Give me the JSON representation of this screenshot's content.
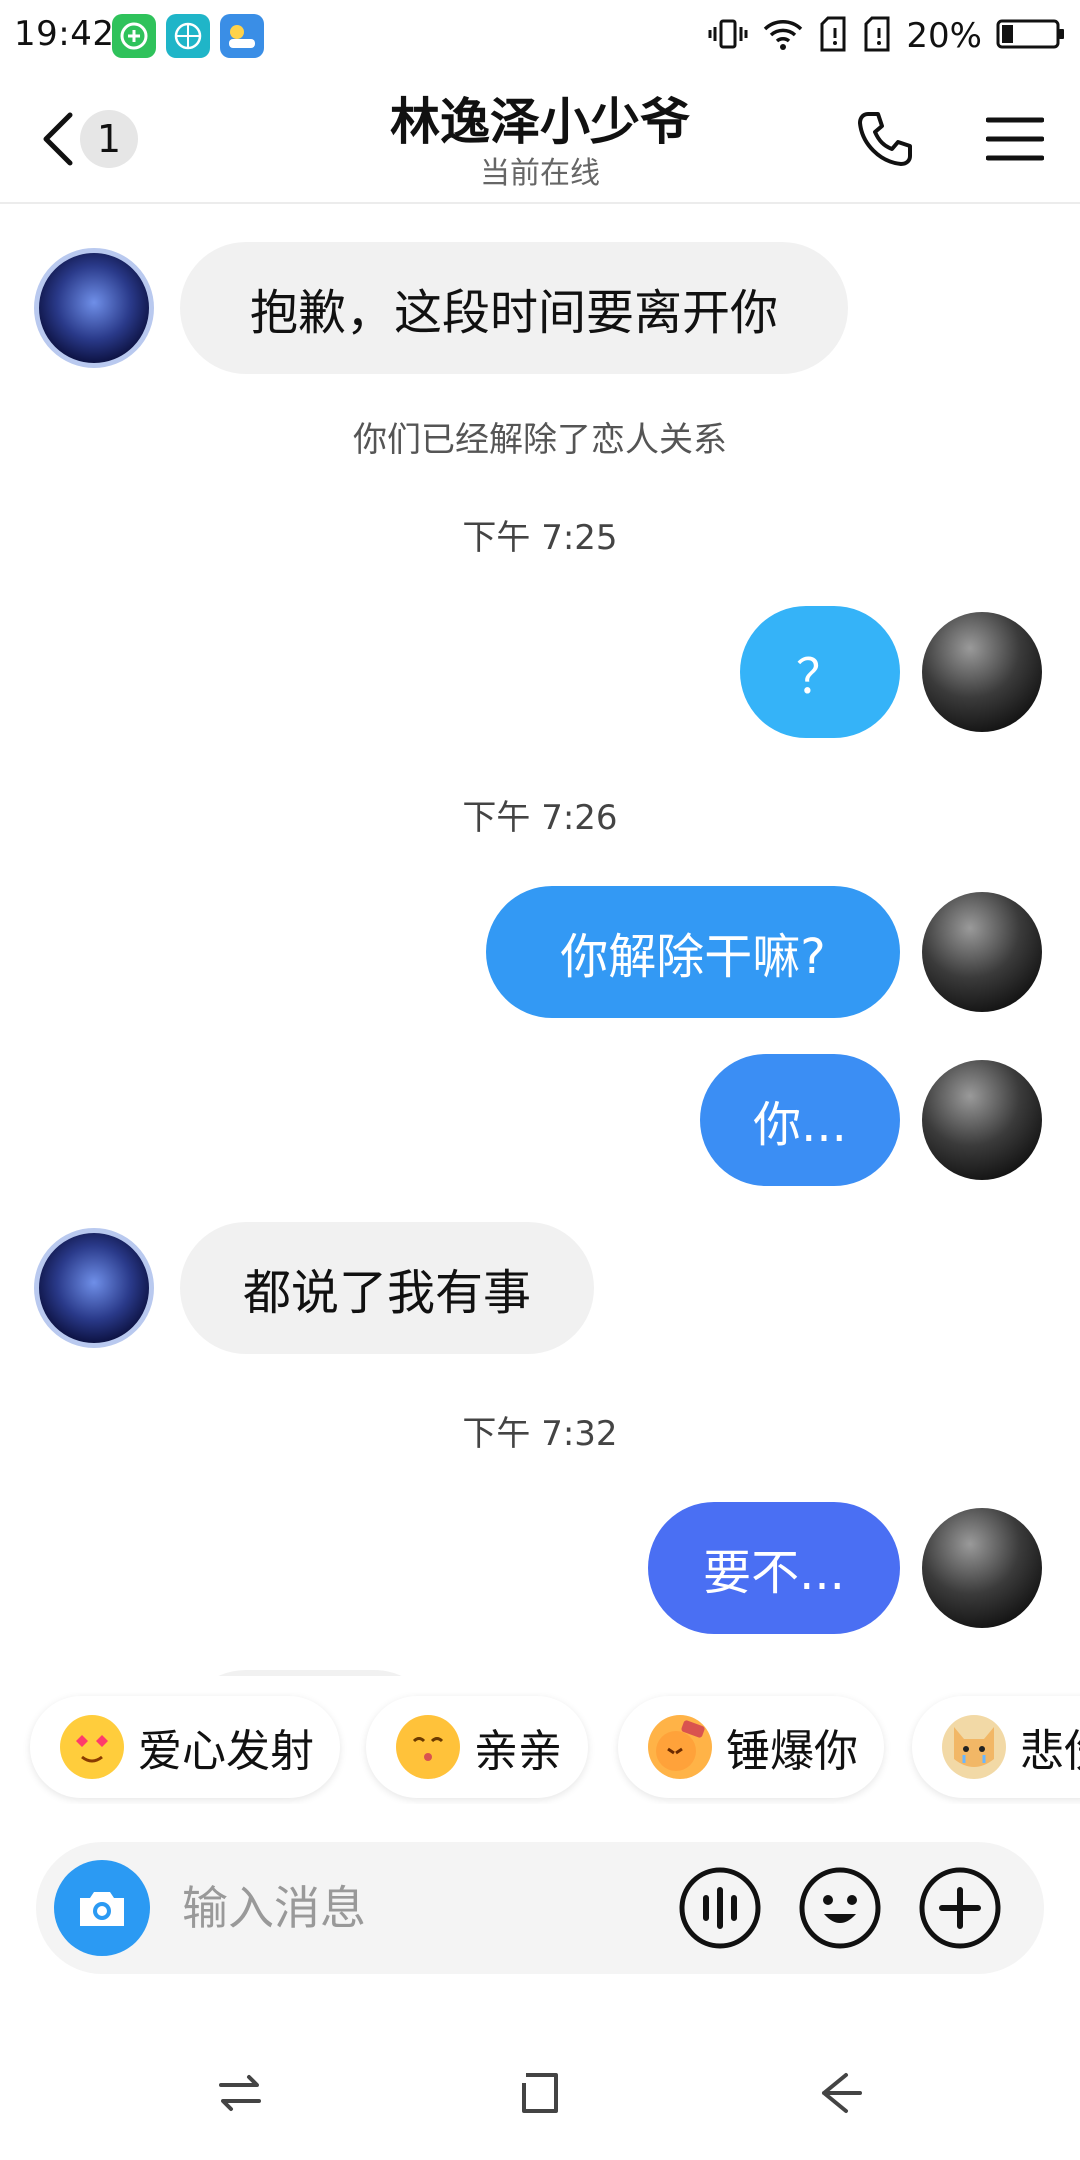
{
  "status_bar": {
    "time": "19:42",
    "battery_percent": "20%",
    "app_icons": [
      "green-app-icon",
      "basketball-app-icon",
      "weather-app-icon"
    ],
    "indicators": [
      "vibrate-icon",
      "wifi-icon",
      "sim1-icon",
      "sim2-icon",
      "battery-icon"
    ]
  },
  "header": {
    "unread_count": "1",
    "title": "林逸泽小少爷",
    "subtitle": "当前在线"
  },
  "colors": {
    "bubble_me_light": "#35b3f8",
    "bubble_me_mid": "#3396f4",
    "bubble_me_deep": "#4a6ff3",
    "bubble_them": "#f1f1f1",
    "camera": "#2b9af3"
  },
  "messages": [
    {
      "kind": "them",
      "text": "抱歉，这段时间要离开你"
    },
    {
      "kind": "system",
      "text": "你们已经解除了恋人关系"
    },
    {
      "kind": "time",
      "text": "下午 7:25"
    },
    {
      "kind": "me",
      "text": "？"
    },
    {
      "kind": "time",
      "text": "下午 7:26"
    },
    {
      "kind": "me",
      "text": "你解除干嘛?"
    },
    {
      "kind": "me",
      "text": "你..."
    },
    {
      "kind": "them",
      "text": "都说了我有事"
    },
    {
      "kind": "time",
      "text": "下午 7:32"
    },
    {
      "kind": "me",
      "text": "要不..."
    }
  ],
  "reactions": [
    {
      "label": "爱心发射",
      "icon": "heart-eyes-emoji-icon"
    },
    {
      "label": "亲亲",
      "icon": "kiss-emoji-icon"
    },
    {
      "label": "锤爆你",
      "icon": "hammer-emoji-icon"
    },
    {
      "label": "悲伤",
      "icon": "dog-emoji-icon"
    }
  ],
  "input": {
    "placeholder": "输入消息"
  },
  "nav": [
    "recent-apps-icon",
    "home-icon",
    "back-icon"
  ]
}
